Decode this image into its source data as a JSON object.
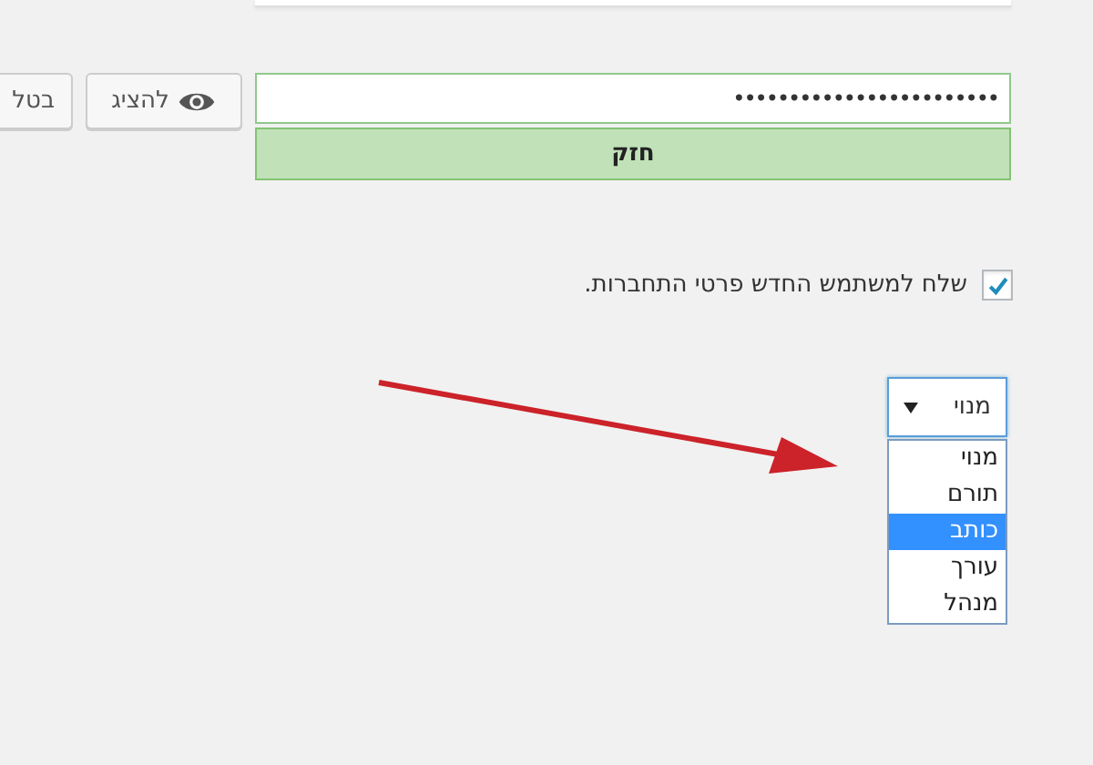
{
  "password": {
    "value": "••••••••••••••••••••••••",
    "strength": "חזק"
  },
  "show_button": "להציג",
  "cancel_button": "בטל",
  "send_notification": {
    "label": "שלח למשתמש החדש פרטי התחברות.",
    "checked": true
  },
  "role": {
    "value": "מנוי",
    "expanded": true,
    "options": [
      {
        "label": "מנוי",
        "highlighted": false
      },
      {
        "label": "תורם",
        "highlighted": false
      },
      {
        "label": "כותב",
        "highlighted": true
      },
      {
        "label": "עורך",
        "highlighted": false
      },
      {
        "label": "מנהל",
        "highlighted": false
      }
    ]
  }
}
